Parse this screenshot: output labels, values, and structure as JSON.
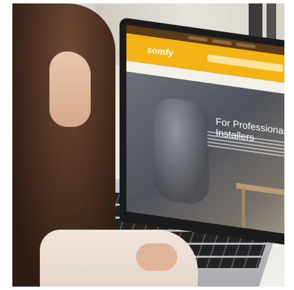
{
  "image": {
    "subject": "woman using laptop viewing website",
    "palette": {
      "hair": "#4a2f20",
      "header": "#f4b315",
      "laptop": "#1b1b1c",
      "keyboard": "#222222"
    }
  },
  "screen": {
    "logo": "somfy",
    "hero_title": "For Professional Installers",
    "nav_items": [
      "",
      "",
      "",
      ""
    ]
  }
}
